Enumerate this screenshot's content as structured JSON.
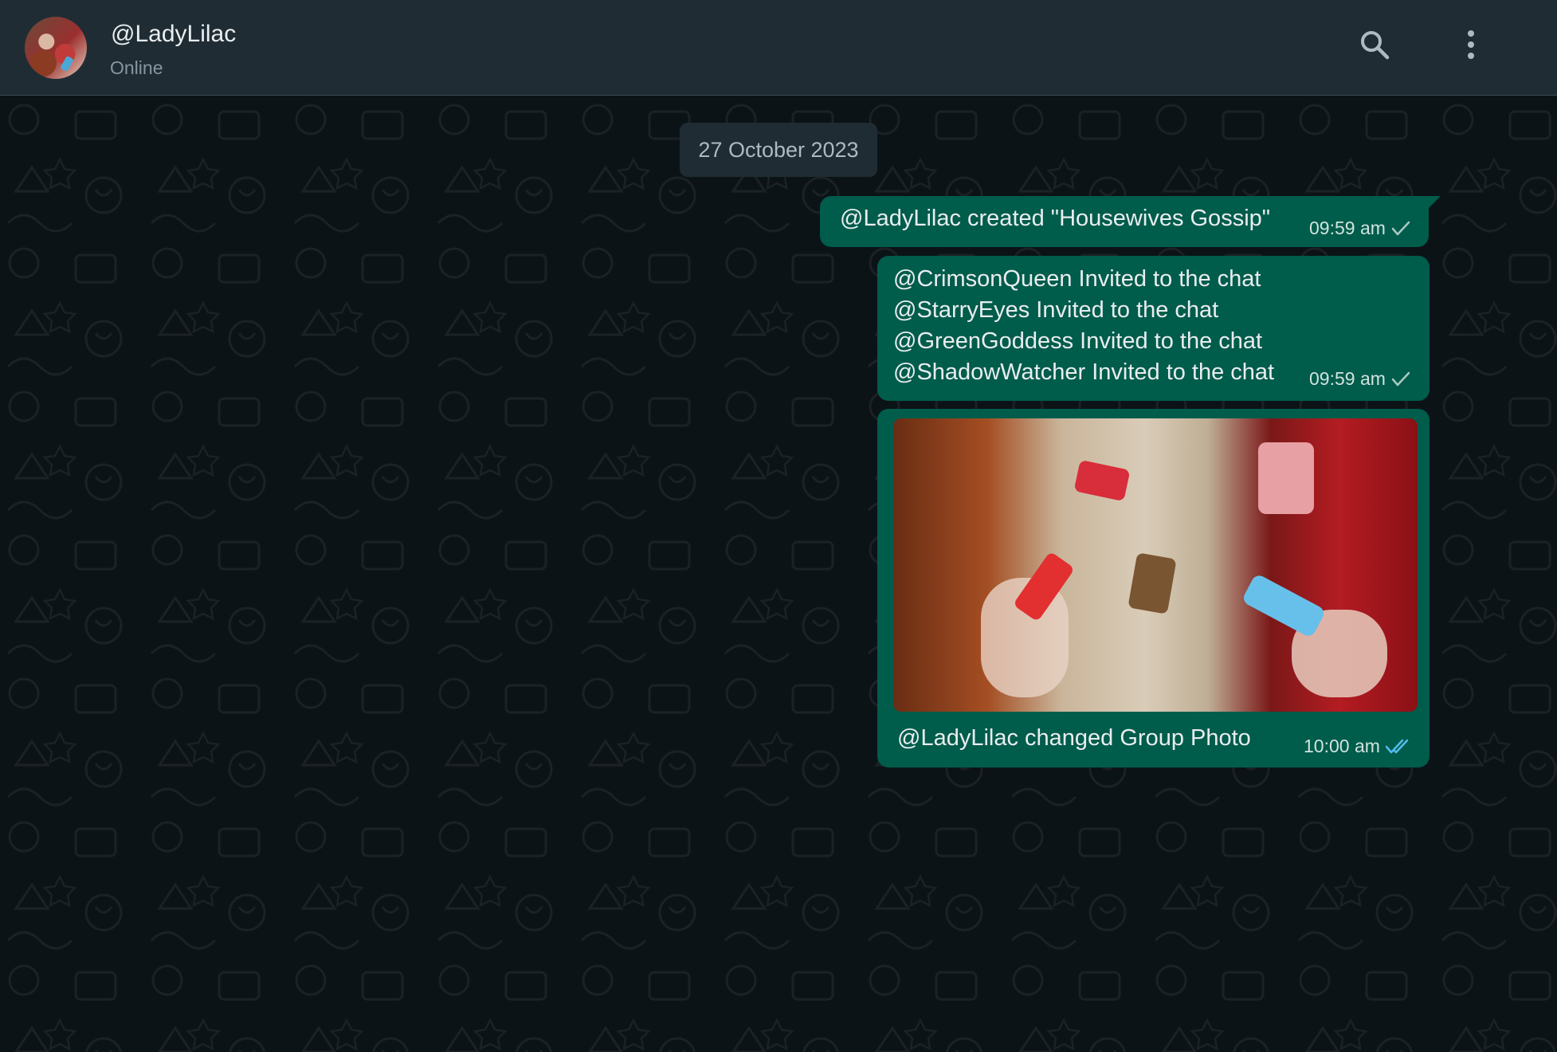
{
  "header": {
    "name": "@LadyLilac",
    "status": "Online"
  },
  "chat": {
    "date_label": "27 October 2023",
    "messages": [
      {
        "text": "@LadyLilac created \"Housewives Gossip\"",
        "time": "09:59 am",
        "status": "sent"
      },
      {
        "lines": [
          " @CrimsonQueen Invited to the chat",
          "@StarryEyes Invited to the chat",
          "@GreenGoddess Invited to the chat",
          "@ShadowWatcher Invited to the chat"
        ],
        "time": "09:59 am",
        "status": "sent"
      },
      {
        "caption": "@LadyLilac changed Group Photo",
        "time": "10:00 am",
        "status": "read"
      }
    ]
  },
  "colors": {
    "header_bg": "#1f2c34",
    "chat_bg": "#0c1317",
    "bubble_out": "#005c4b",
    "read_tick": "#53bdeb"
  },
  "icons": {
    "search": "search-icon",
    "menu": "more-vertical-icon",
    "sent": "single-check-icon",
    "read": "double-check-icon"
  }
}
